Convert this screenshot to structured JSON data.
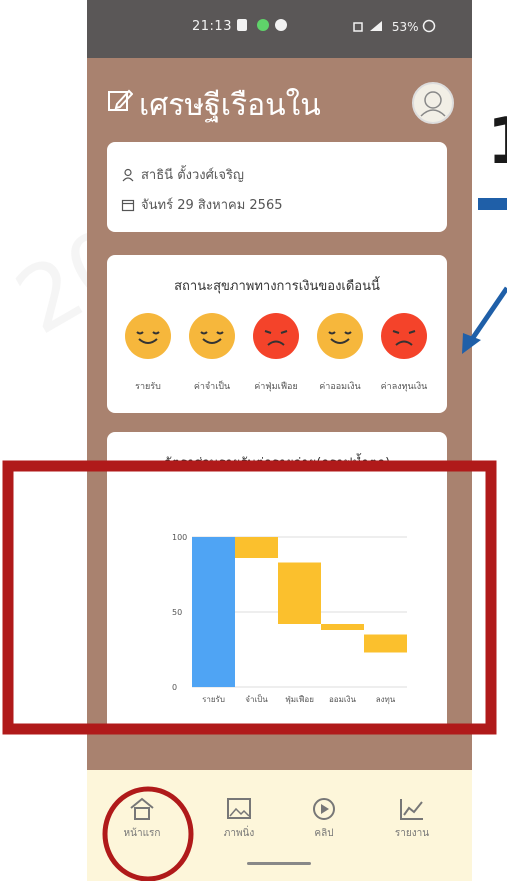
{
  "status_bar": {
    "time": "21:13",
    "right": "53%"
  },
  "app": {
    "title": "เศรษฐีเรือนใน"
  },
  "user": {
    "name": "สาธินี ตั้งวงศ์เจริญ",
    "date": "จันทร์ 29 สิงหาคม 2565"
  },
  "status": {
    "title": "สถานะสุขภาพทางการเงินของเดือนนี้",
    "items": [
      {
        "label": "รายรับ",
        "mood": "happy",
        "color": "#f6b73c"
      },
      {
        "label": "ค่าจำเป็น",
        "mood": "happy",
        "color": "#f6b73c"
      },
      {
        "label": "ค่าฟุ่มเฟือย",
        "mood": "sad",
        "color": "#f4432a"
      },
      {
        "label": "ค่าออมเงิน",
        "mood": "happy",
        "color": "#f6b73c"
      },
      {
        "label": "ค่าลงทุนเงิน",
        "mood": "sad",
        "color": "#f4432a"
      }
    ]
  },
  "chart": {
    "title": "อัตราส่วนรายรับต่อรายจ่าย(กราฟน้ำตก)"
  },
  "chart_data": {
    "type": "bar",
    "categories": [
      "รายรับ",
      "จำเป็น",
      "ฟุ่มเฟือย",
      "ออมเงิน",
      "ลงทุน"
    ],
    "ranges": [
      [
        0,
        100
      ],
      [
        86,
        100
      ],
      [
        42,
        83
      ],
      [
        38,
        42
      ],
      [
        23,
        35
      ]
    ],
    "ylim": [
      0,
      100
    ],
    "yticks": [
      "0",
      "50",
      "100"
    ],
    "colors": [
      "#4fa4f4",
      "#fbc02d",
      "#fbc02d",
      "#fbc02d",
      "#fbc02d"
    ]
  },
  "nav": {
    "items": [
      {
        "label": "หน้าแรก"
      },
      {
        "label": "ภาพนิ่ง"
      },
      {
        "label": "คลิป"
      },
      {
        "label": "รายงาน"
      }
    ]
  },
  "annotation": {
    "number": "1"
  },
  "colors": {
    "app_bg": "#a9826f",
    "status_bar": "#5a5757",
    "nav_bg": "#fdf6da",
    "annotation_red": "#b01a1a",
    "annotation_arrow": "#1f5fa8"
  }
}
